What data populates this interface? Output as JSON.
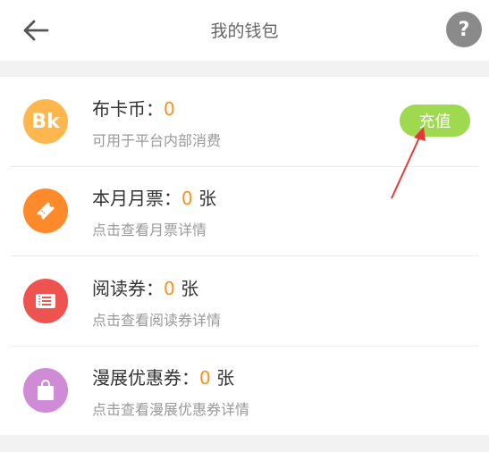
{
  "header": {
    "title": "我的钱包",
    "back_icon": "back-arrow-icon",
    "help_label": "?"
  },
  "wallet": {
    "items": [
      {
        "title": "布卡币：",
        "value": "0",
        "unit": "",
        "subtitle": "可用于平台内部消费",
        "icon": "bk-coin-icon",
        "icon_text": "Bk",
        "icon_color": "#ffb74d",
        "action_label": "充值"
      },
      {
        "title": "本月月票：",
        "value": "0",
        "unit": " 张",
        "subtitle": "点击查看月票详情",
        "icon": "ticket-icon",
        "icon_color": "#ff8a2b"
      },
      {
        "title": "阅读券：",
        "value": "0",
        "unit": " 张",
        "subtitle": "点击查看阅读券详情",
        "icon": "coupon-icon",
        "icon_color": "#ef5350"
      },
      {
        "title": "漫展优惠券：",
        "value": "0",
        "unit": " 张",
        "subtitle": "点击查看漫展优惠券详情",
        "icon": "shopping-bag-icon",
        "icon_color": "#d08bd6"
      }
    ]
  },
  "colors": {
    "value_accent": "#f7911d",
    "recharge_button": "#9fd94f",
    "annotation_arrow": "#e53935"
  }
}
